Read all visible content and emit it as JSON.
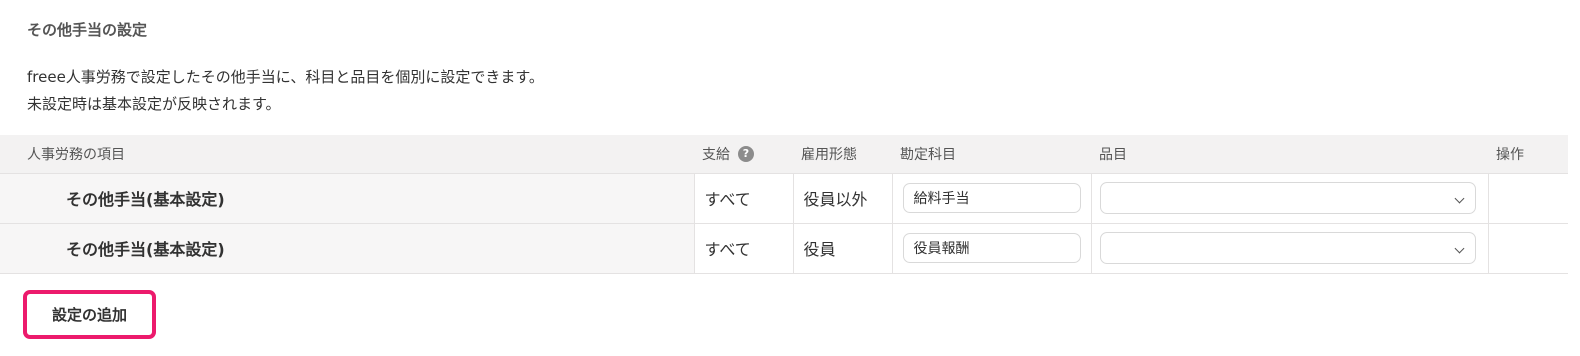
{
  "section": {
    "title": "その他手当の設定",
    "description_lines": [
      "freee人事労務で設定したその他手当に、科目と品目を個別に設定できます。",
      "未設定時は基本設定が反映されます。"
    ]
  },
  "table": {
    "headers": {
      "item": "人事労務の項目",
      "payment": "支給",
      "employment": "雇用形態",
      "account": "勘定科目",
      "product": "品目",
      "operation": "操作"
    },
    "help_icon": {
      "name": "question-circle-icon",
      "glyph": "?"
    },
    "rows": [
      {
        "item": "その他手当(基本設定)",
        "payment": "すべて",
        "employment": "役員以外",
        "account": "給料手当",
        "product": ""
      },
      {
        "item": "その他手当(基本設定)",
        "payment": "すべて",
        "employment": "役員",
        "account": "役員報酬",
        "product": ""
      }
    ]
  },
  "add_button": {
    "label": "設定の追加"
  },
  "colors": {
    "highlight": "#ec1a6c",
    "header_bg": "#f3f2f2",
    "border": "#e4e2e2"
  }
}
